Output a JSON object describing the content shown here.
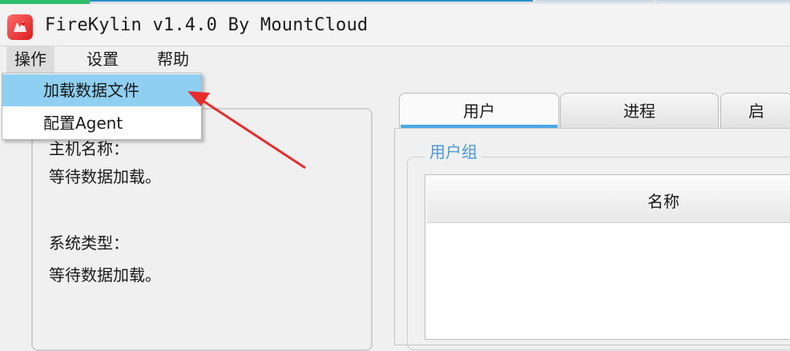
{
  "window": {
    "title": "FireKylin v1.4.0 By MountCloud"
  },
  "menubar": {
    "items": [
      {
        "label": "操作"
      },
      {
        "label": "设置"
      },
      {
        "label": "帮助"
      }
    ]
  },
  "dropdown": {
    "items": [
      {
        "label": "加载数据文件",
        "highlighted": true
      },
      {
        "label": "配置Agent"
      }
    ]
  },
  "left_panel": {
    "hostname_label": "主机名称：",
    "hostname_value": "等待数据加载。",
    "system_type_label": "系统类型：",
    "system_type_value": "等待数据加载。"
  },
  "tabs": [
    {
      "label": "用户",
      "active": true
    },
    {
      "label": "进程"
    },
    {
      "label": "启"
    }
  ],
  "user_group": {
    "title": "用户组",
    "columns": [
      "名称"
    ]
  },
  "icons": {
    "app": "firekylin-app-icon",
    "annotation": "red-arrow-annotation"
  },
  "colors": {
    "highlight": "#8fcff2",
    "tab_accent": "#4aa8e6",
    "group_title": "#4a9bd6",
    "arrow": "#e82b2b"
  }
}
